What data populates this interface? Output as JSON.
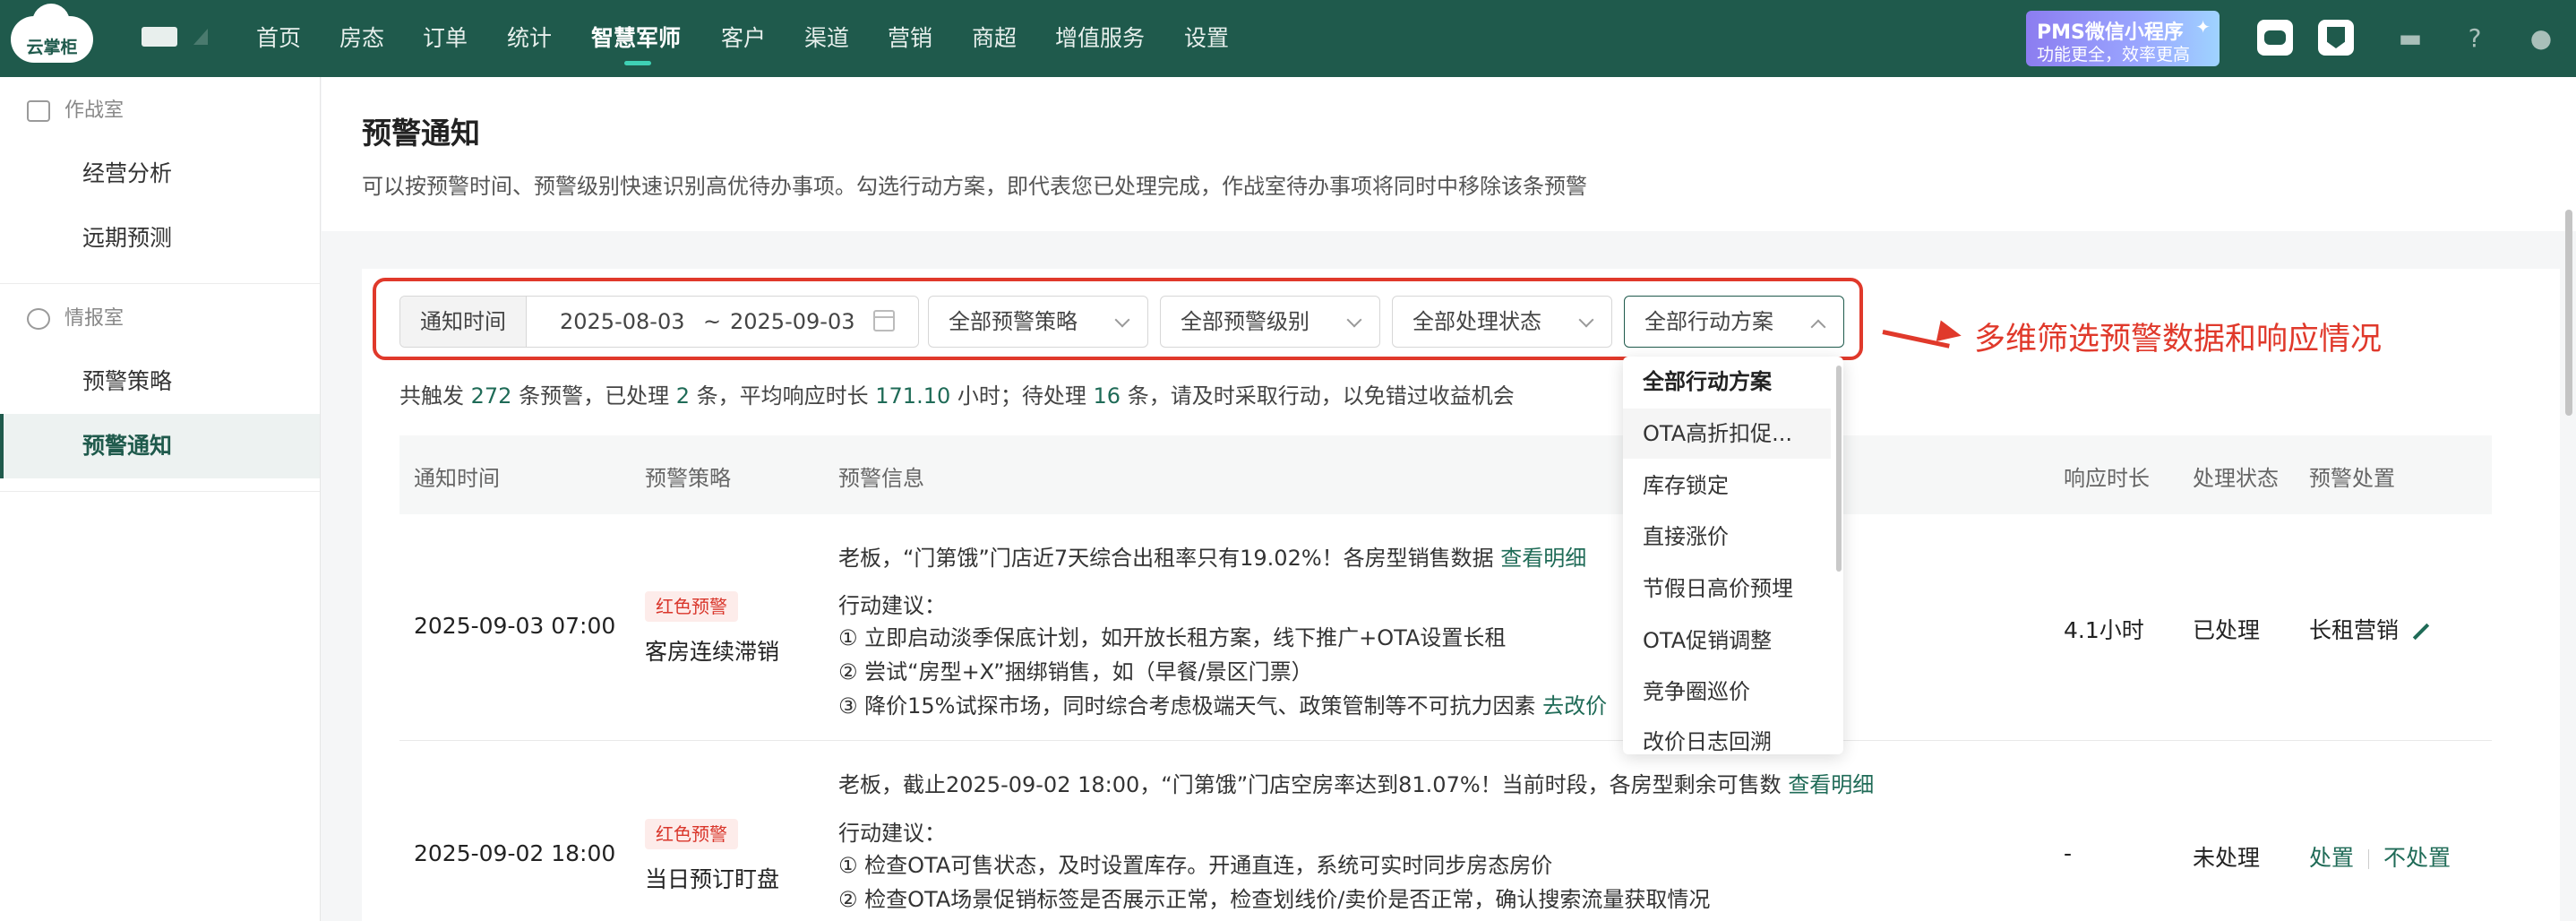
{
  "topnav": {
    "logo_text": "云掌柜",
    "items": [
      "首页",
      "房态",
      "订单",
      "统计",
      "智慧军师",
      "客户",
      "渠道",
      "营销",
      "商超",
      "增值服务",
      "设置"
    ],
    "active": "智慧军师",
    "promo": {
      "line1": "PMS微信小程序",
      "line2": "功能更全，效率更高"
    }
  },
  "sidebar": {
    "groups": [
      {
        "title": "作战室",
        "items": [
          "经营分析",
          "远期预测"
        ]
      },
      {
        "title": "情报室",
        "items": [
          "预警策略",
          "预警通知"
        ]
      }
    ],
    "active": "预警通知"
  },
  "header": {
    "title": "预警通知",
    "description": "可以按预警时间、预警级别快速识别高优待办事项。勾选行动方案，即代表您已处理完成，作战室待办事项将同时中移除该条预警"
  },
  "filters": {
    "time_label": "通知时间",
    "date_start": "2025-08-03",
    "date_sep": "~",
    "date_end": "2025-09-03",
    "strategy": "全部预警策略",
    "level": "全部预警级别",
    "status": "全部处理状态",
    "action": "全部行动方案"
  },
  "annotation": "多维筛选预警数据和响应情况",
  "summary": {
    "p1": "共触发 ",
    "triggered": "272",
    "p2": " 条预警，已处理 ",
    "handled": "2",
    "p3": " 条，平均响应时长 ",
    "avg": "171.10",
    "p4": " 小时；待处理 ",
    "pending": "16",
    "p5": " 条，请及时采取行动，以免错过收益机会"
  },
  "table": {
    "headers": [
      "通知时间",
      "预警策略",
      "预警信息",
      "响应时长",
      "处理状态",
      "预警处置"
    ],
    "rows": [
      {
        "time": "2025-09-03 07:00",
        "badge": "红色预警",
        "strategy": "客房连续滞销",
        "headline": "老板，“门第饿”门店近7天综合出租率只有19.02%！各房型销售数据",
        "headline_link": "查看明细",
        "advice_title": "行动建议：",
        "advice": [
          "① 立即启动淡季保底计划，如开放长租方案，线下推广+OTA设置长租",
          "② 尝试“房型+X”捆绑销售，如（早餐/景区门票）",
          "③ 降价15%试探市场，同时综合考虑极端天气、政策管制等不可抗力因素"
        ],
        "advice_link": "去改价",
        "response": "4.1小时",
        "status": "已处理",
        "disposal": "长租营销"
      },
      {
        "time": "2025-09-02 18:00",
        "badge": "红色预警",
        "strategy": "当日预订盯盘",
        "headline": "老板，截止2025-09-02 18:00，“门第饿”门店空房率达到81.07%！当前时段，各房型剩余可售数",
        "headline_link": "查看明细",
        "advice_title": "行动建议：",
        "advice": [
          "① 检查OTA可售状态，及时设置库存。开通直连，系统可实时同步房态房价",
          "② 检查OTA场景促销标签是否展示正常，检查划线价/卖价是否正常，确认搜索流量获取情况"
        ],
        "response": "-",
        "status": "未处理",
        "action_handle": "处置",
        "action_skip": "不处置"
      }
    ]
  },
  "dropdown": {
    "options": [
      "全部行动方案",
      "OTA高折扣促...",
      "库存锁定",
      "直接涨价",
      "节假日高价预埋",
      "OTA促销调整",
      "竞争圈巡价",
      "改价日志回溯"
    ],
    "selected": "全部行动方案",
    "hovered": "OTA高折扣促..."
  },
  "colors": {
    "brand": "#1f5a4c",
    "accent": "#1f6b57",
    "alert": "#e0392b"
  }
}
